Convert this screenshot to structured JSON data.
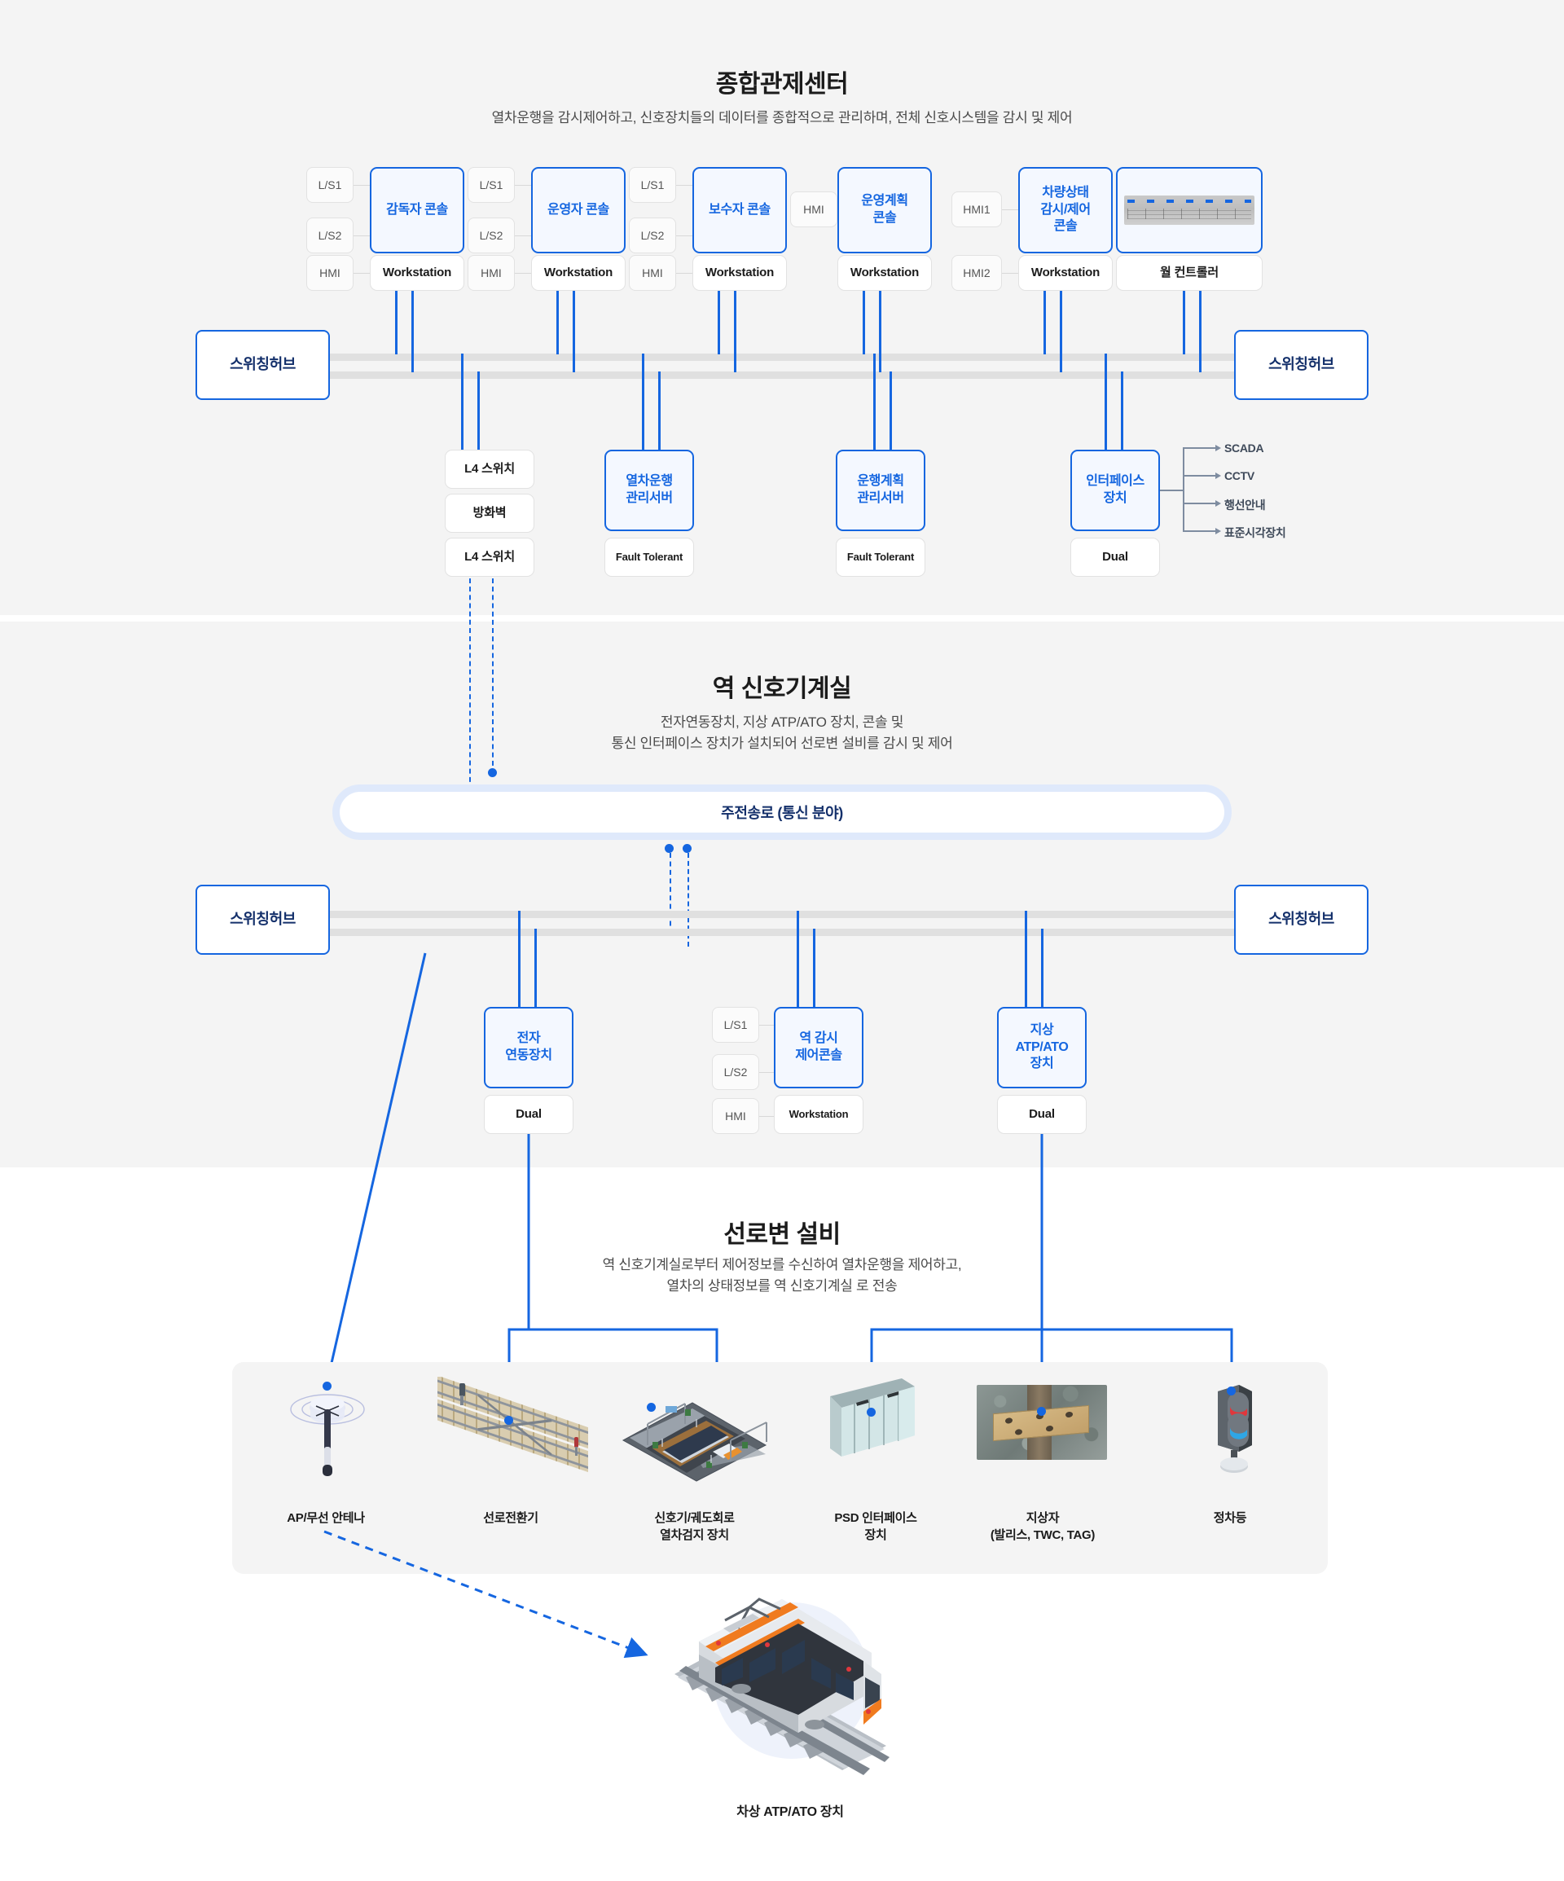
{
  "sections": [
    {
      "id": "ops",
      "title": "종합관제센터",
      "subtitle": "열차운행을 감시제어하고, 신호장치들의 데이터를 종합적으로 관리하며, 전체 신호시스템을 감시 및 제어"
    },
    {
      "id": "station",
      "title": "역 신호기계실",
      "subtitle_line1": "전자연동장치, 지상 ATP/ATO 장치, 콘솔 및",
      "subtitle_line2": "통신 인터페이스 장치가 설치되어 선로변 설비를 감시 및 제어"
    },
    {
      "id": "trackside",
      "title": "선로변 설비",
      "subtitle_line1": "역 신호기계실로부터 제어정보를 수신하여 열차운행을 제어하고,",
      "subtitle_line2": "열차의 상태정보를 역 신호기계실 로 전송"
    }
  ],
  "ops": {
    "hub_left": "스위칭허브",
    "hub_right": "스위칭허브",
    "consoles": [
      {
        "name": "감독자 콘솔",
        "caption": "Workstation",
        "chips": [
          "L/S1",
          "L/S2",
          "HMI"
        ]
      },
      {
        "name": "운영자 콘솔",
        "caption": "Workstation",
        "chips": [
          "L/S1",
          "L/S2",
          "HMI"
        ]
      },
      {
        "name": "보수자 콘솔",
        "caption": "Workstation",
        "chips": [
          "L/S1",
          "L/S2",
          "HMI"
        ]
      },
      {
        "name": "운영계획\n콘솔",
        "caption": "Workstation",
        "chips": [
          "HMI"
        ]
      },
      {
        "name": "차량상태\n감시/제어\n콘솔",
        "caption": "Workstation",
        "chips": [
          "HMI1",
          "HMI2"
        ]
      },
      {
        "name": "",
        "caption": "월 컨트롤러",
        "chips": []
      }
    ],
    "servers": [
      {
        "name": "L4 스위치",
        "caption": "방화벽",
        "caption2": "L4 스위치",
        "style": "stack-white"
      },
      {
        "name": "열차운행\n관리서버",
        "caption": "Fault Tolerant",
        "style": "blue"
      },
      {
        "name": "운행계획\n관리서버",
        "caption": "Fault Tolerant",
        "style": "blue"
      },
      {
        "name": "인터페이스\n장치",
        "caption": "Dual",
        "style": "blue"
      }
    ],
    "interface_outputs": [
      "SCADA",
      "CCTV",
      "행선안내",
      "표준시각장치"
    ]
  },
  "station": {
    "main_transmission": "주전송로 (통신 분야)",
    "hub_left": "스위칭허브",
    "hub_right": "스위칭허브",
    "devices": [
      {
        "name": "전자\n연동장치",
        "caption": "Dual",
        "chips": []
      },
      {
        "name": "역 감시\n제어콘솔",
        "caption": "Workstation",
        "chips": [
          "L/S1",
          "L/S2",
          "HMI"
        ]
      },
      {
        "name": "지상\nATP/ATO\n장치",
        "caption": "Dual",
        "chips": []
      }
    ]
  },
  "trackside": {
    "items": [
      {
        "label": "AP/무선 안테나",
        "icon": "antenna-icon"
      },
      {
        "label": "선로전환기",
        "icon": "track-switch-icon"
      },
      {
        "label": "신호기/궤도회로\n열차검지 장치",
        "icon": "platform-signal-icon"
      },
      {
        "label": "PSD 인터페이스\n장치",
        "icon": "psd-icon"
      },
      {
        "label": "지상자\n(발리스, TWC, TAG)",
        "icon": "balise-icon"
      },
      {
        "label": "정차등",
        "icon": "stop-lamp-icon"
      }
    ],
    "train_label": "차상 ATP/ATO 장치"
  },
  "colors": {
    "accent_blue": "#1566e0",
    "dark_navy": "#14306b",
    "band_bg": "#f4f4f4",
    "bus_grey": "#e0e0e0"
  }
}
